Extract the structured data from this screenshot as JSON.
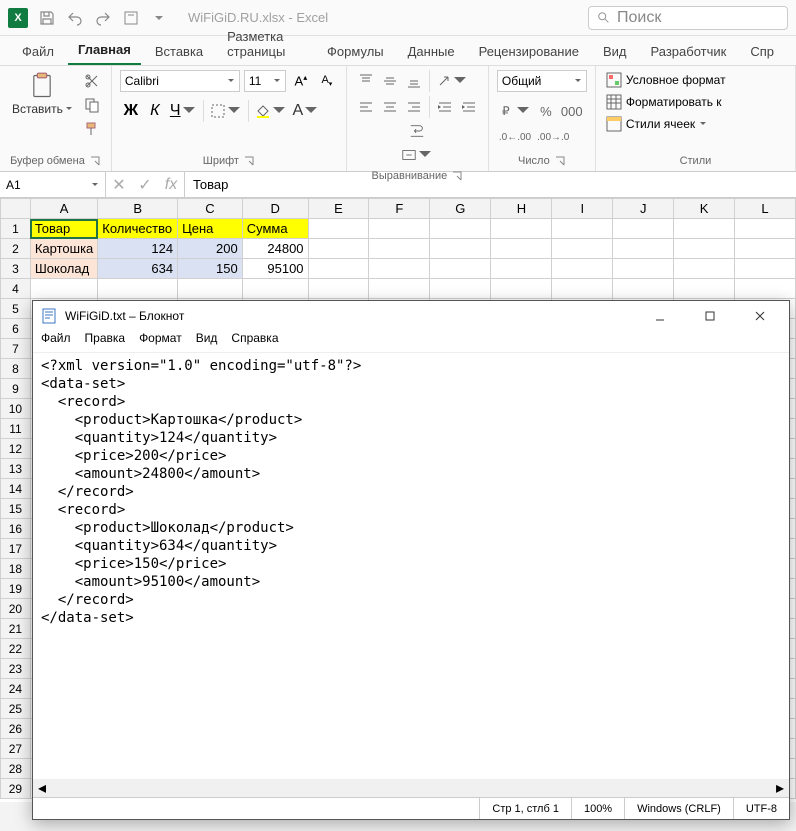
{
  "title_bar": {
    "doc_name": "WiFiGiD.RU.xlsx - Excel",
    "search_placeholder": "Поиск"
  },
  "tabs": {
    "file": "Файл",
    "home": "Главная",
    "insert": "Вставка",
    "layout": "Разметка страницы",
    "formulas": "Формулы",
    "data": "Данные",
    "review": "Рецензирование",
    "view": "Вид",
    "developer": "Разработчик",
    "extra": "Спр"
  },
  "ribbon": {
    "clipboard": {
      "paste": "Вставить",
      "label": "Буфер обмена"
    },
    "font": {
      "name": "Calibri",
      "size": "11",
      "label": "Шрифт"
    },
    "alignment": {
      "label": "Выравнивание"
    },
    "number": {
      "format": "Общий",
      "label": "Число"
    },
    "styles": {
      "conditional": "Условное формат",
      "table": "Форматировать к",
      "cell_styles": "Стили ячеек",
      "label": "Стили"
    }
  },
  "name_box": {
    "ref": "A1"
  },
  "formula_bar": {
    "value": "Товар"
  },
  "sheet": {
    "cols": [
      "A",
      "B",
      "C",
      "D",
      "E",
      "F",
      "G",
      "H",
      "I",
      "J",
      "K",
      "L"
    ],
    "headers": [
      "Товар",
      "Количество",
      "Цена",
      "Сумма"
    ],
    "rows": [
      {
        "product": "Картошка",
        "qty": "124",
        "price": "200",
        "amount": "24800"
      },
      {
        "product": "Шоколад",
        "qty": "634",
        "price": "150",
        "amount": "95100"
      }
    ]
  },
  "notepad": {
    "title": "WiFiGiD.txt – Блокнот",
    "menu": {
      "file": "Файл",
      "edit": "Правка",
      "format": "Формат",
      "view": "Вид",
      "help": "Справка"
    },
    "content": "<?xml version=\"1.0\" encoding=\"utf-8\"?>\n<data-set>\n  <record>\n    <product>Картошка</product>\n    <quantity>124</quantity>\n    <price>200</price>\n    <amount>24800</amount>\n  </record>\n  <record>\n    <product>Шоколад</product>\n    <quantity>634</quantity>\n    <price>150</price>\n    <amount>95100</amount>\n  </record>\n</data-set>",
    "status": {
      "pos": "Стр 1, стлб 1",
      "zoom": "100%",
      "eol": "Windows (CRLF)",
      "enc": "UTF-8"
    }
  }
}
